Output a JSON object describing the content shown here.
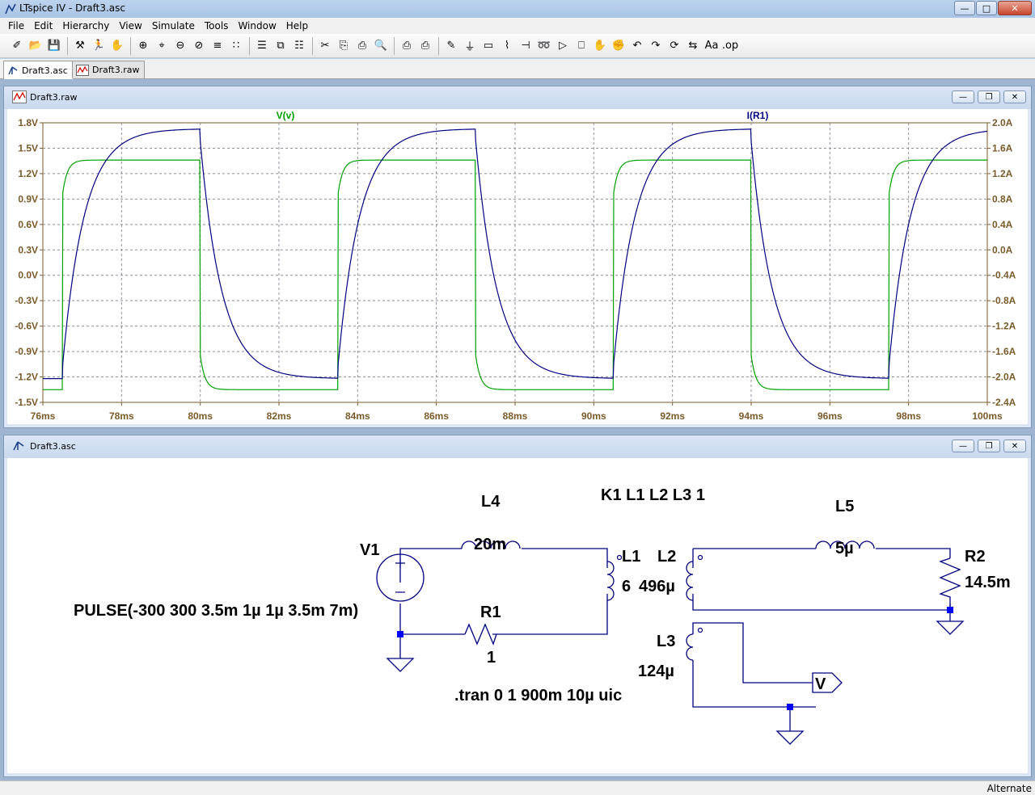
{
  "window": {
    "title": "LTspice IV - Draft3.asc",
    "buttons": [
      "minimize",
      "maximize",
      "close"
    ]
  },
  "menu": [
    "File",
    "Edit",
    "Hierarchy",
    "View",
    "Simulate",
    "Tools",
    "Window",
    "Help"
  ],
  "toolbar_icons": [
    "new-schematic-icon",
    "open-icon",
    "save-icon",
    "control-panel-icon",
    "run-icon",
    "halt-icon",
    "zoom-in-icon",
    "zoom-pan-icon",
    "zoom-out-icon",
    "zoom-fit-icon",
    "autorange-icon",
    "grid-icon",
    "tile-horizontal-icon",
    "cascade-icon",
    "tile-vertical-icon",
    "cut-icon",
    "copy-icon",
    "paste-icon",
    "find-icon",
    "print-preview-icon",
    "print-icon",
    "wire-icon",
    "ground-icon",
    "label-icon",
    "resistor-icon",
    "capacitor-icon",
    "inductor-icon",
    "diode-icon",
    "component-icon",
    "move-icon",
    "drag-icon",
    "undo-icon",
    "redo-icon",
    "rotate-icon",
    "mirror-icon",
    "text-icon",
    "spice-directive-icon"
  ],
  "tabs": [
    {
      "label": "Draft3.asc",
      "icon": "schematic-icon",
      "active": true
    },
    {
      "label": "Draft3.raw",
      "icon": "waveform-icon",
      "active": false
    }
  ],
  "waveform_window": {
    "title": "Draft3.raw"
  },
  "schematic_window": {
    "title": "Draft3.asc"
  },
  "chart_data": {
    "type": "line",
    "title": "",
    "xlabel": "",
    "ylabel": "",
    "x_ticks": [
      "76ms",
      "78ms",
      "80ms",
      "82ms",
      "84ms",
      "86ms",
      "88ms",
      "90ms",
      "92ms",
      "94ms",
      "96ms",
      "98ms",
      "100ms"
    ],
    "xlim": [
      76,
      100
    ],
    "left_axis": {
      "ticks": [
        "1.8V",
        "1.5V",
        "1.2V",
        "0.9V",
        "0.6V",
        "0.3V",
        "0.0V",
        "-0.3V",
        "-0.6V",
        "-0.9V",
        "-1.2V",
        "-1.5V"
      ],
      "ylim": [
        -1.5,
        1.8
      ],
      "color": "#7a5a2a"
    },
    "right_axis": {
      "ticks": [
        "2.0A",
        "1.6A",
        "1.2A",
        "0.8A",
        "0.4A",
        "0.0A",
        "-0.4A",
        "-0.8A",
        "-1.2A",
        "-1.6A",
        "-2.0A",
        "-2.4A"
      ],
      "ylim": [
        -2.4,
        2.0
      ],
      "color": "#7a5a2a"
    },
    "grid": true,
    "series": [
      {
        "name": "V(v)",
        "color": "#00a000",
        "axis": "left",
        "high": 1.36,
        "low": -1.35,
        "tau_ms": 0.12,
        "edges": [
          76.5,
          80.0,
          83.5,
          87.0,
          90.5,
          94.0,
          97.5
        ]
      },
      {
        "name": "I(R1)",
        "color": "#000080",
        "axis": "left",
        "high": 1.73,
        "low": -1.22,
        "tau_ms": 0.55,
        "edges": [
          76.5,
          80.0,
          83.5,
          87.0,
          90.5,
          94.0,
          97.5
        ]
      }
    ],
    "pulse": {
      "period_ms": 7.0,
      "high_start_ms": 76.5,
      "half_period_ms": 3.5
    }
  },
  "schematic": {
    "components": {
      "v1": {
        "name": "V1",
        "value": "PULSE(-300 300 3.5m 1µ 1µ 3.5m 7m)"
      },
      "l4": {
        "name": "L4",
        "value": "20m"
      },
      "r1": {
        "name": "R1",
        "value": "1"
      },
      "l1": {
        "name": "L1",
        "value": "6"
      },
      "l2": {
        "name": "L2",
        "value": "496µ"
      },
      "l5": {
        "name": "L5",
        "value": "5µ"
      },
      "r2": {
        "name": "R2",
        "value": "14.5m"
      },
      "l3": {
        "name": "L3",
        "value": "124µ"
      }
    },
    "coupling_directive": "K1 L1 L2 L3 1",
    "tran_directive": ".tran 0 1 900m 10µ uic",
    "net_label": "V"
  },
  "status": {
    "text": "Alternate"
  },
  "colors": {
    "wire": "#000080",
    "symbol": "#000080",
    "node": "#0000ff",
    "axis_text": "#7a5a2a",
    "grid": "#9aa0a8"
  }
}
